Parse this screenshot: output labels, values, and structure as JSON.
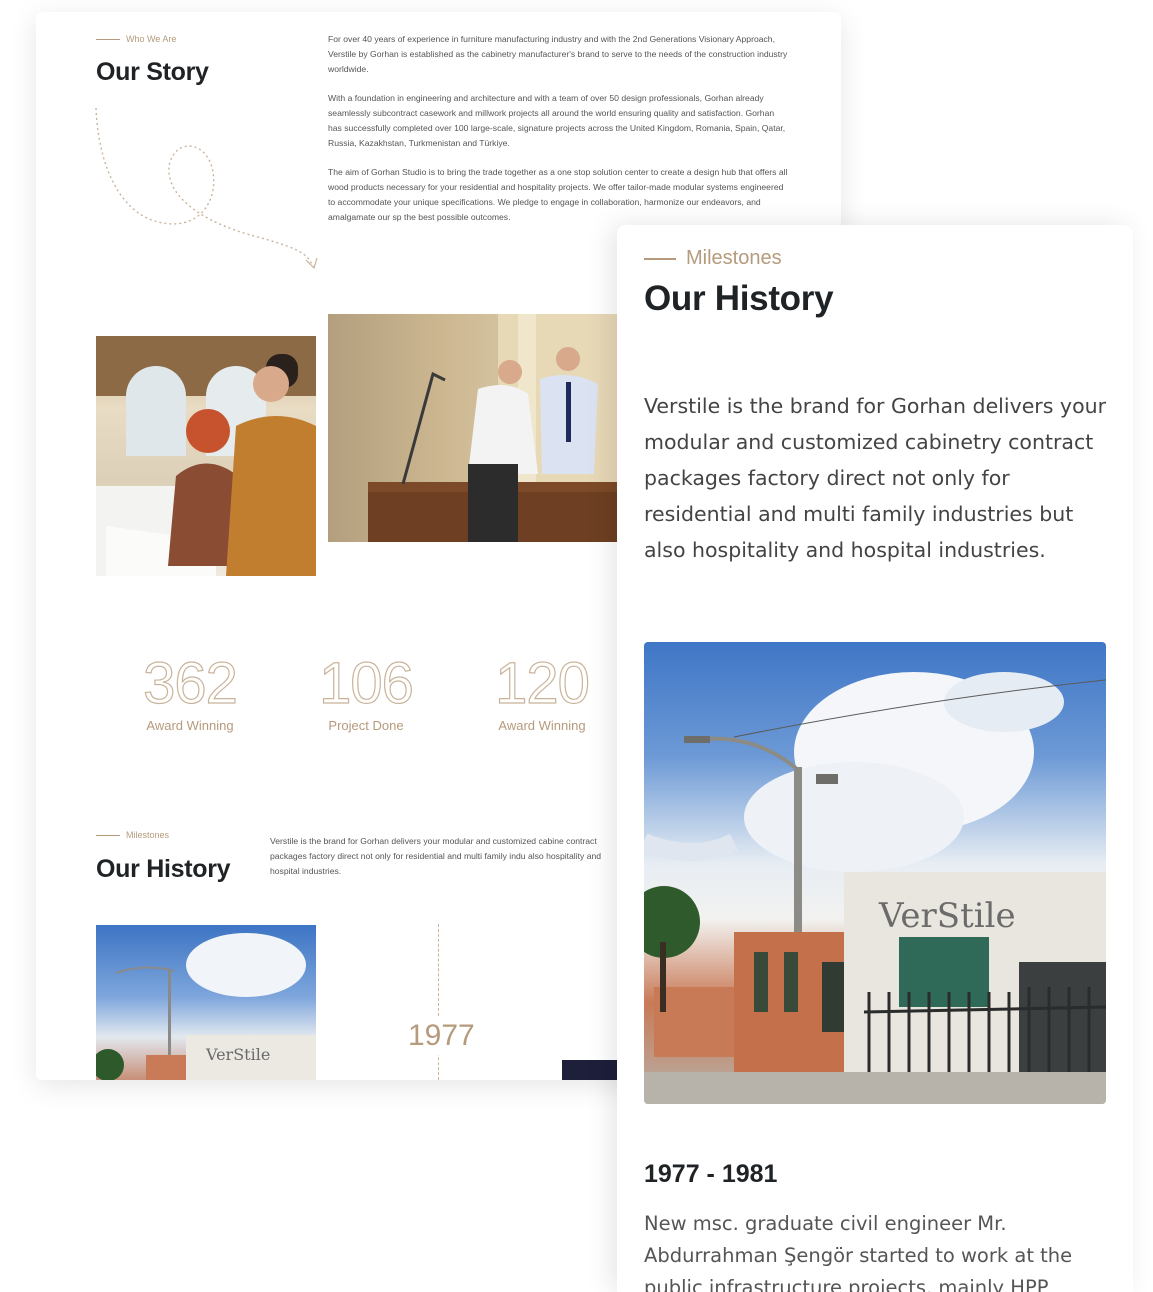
{
  "story": {
    "eyebrow": "Who We Are",
    "title": "Our Story",
    "paragraphs": [
      "For over 40 years of experience in furniture manufacturing industry and with the 2nd Generations Visionary Approach, Verstile by Gorhan is established as the cabinetry manufacturer's brand to serve to the needs of the construction industry worldwide.",
      "With a foundation in engineering and architecture and with a team of over 50 design professionals, Gorhan already seamlessly subcontract casework and millwork projects all around the world ensuring quality and satisfaction. Gorhan has successfully completed over 100 large-scale, signature projects across the United Kingdom, Romania, Spain, Qatar, Russia, Kazakhstan, Turkmenistan and Türkiye.",
      "The aim of Gorhan Studio is to bring the trade together as a one stop solution center to create a design hub that offers all wood products necessary for your residential and hospitality projects. We offer tailor-made modular systems engineered to accommodate your unique specifications. We pledge to engage in collaboration, harmonize our endeavors, and amalgamate our sp the best possible outcomes."
    ]
  },
  "stats": [
    {
      "number": "362",
      "label": "Award Winning"
    },
    {
      "number": "106",
      "label": "Project Done"
    },
    {
      "number": "120",
      "label": "Award Winning"
    }
  ],
  "history_desktop": {
    "eyebrow": "Milestones",
    "title": "Our History",
    "text": "Verstile is the brand for Gorhan delivers your modular and customized cabine contract packages factory direct not only for residential and multi family indu also hospitality and hospital industries.",
    "year": "1977",
    "building_sign": "VerStile"
  },
  "history_mobile": {
    "eyebrow": "Milestones",
    "title": "Our History",
    "text": "Verstile is the brand for Gorhan delivers your modular and customized cabinetry contract packages factory direct not only for residential and multi family industries but also hospitality and hospital industries.",
    "building_sign": "VerStile",
    "range": "1977 - 1981",
    "description": "New msc. graduate civil engineer Mr. Abdurrahman Şengör started to work at the public infrastructure projects, mainly HPP"
  },
  "colors": {
    "accent": "#b59b7c",
    "heading": "#1f2326",
    "navy": "#1d1f3b"
  }
}
